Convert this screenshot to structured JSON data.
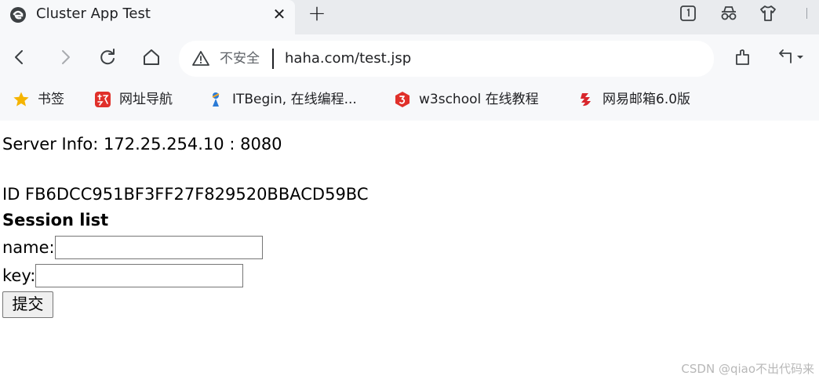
{
  "tab": {
    "title": "Cluster App Test",
    "close_glyph": "✕",
    "new_glyph": "+"
  },
  "toolbar": {
    "security_label": "不安全",
    "url": "haha.com/test.jsp"
  },
  "bookmarks": [
    {
      "label": "书签",
      "icon": "star-icon"
    },
    {
      "label": "网址导航",
      "icon": "red-square-icon"
    },
    {
      "label": "ITBegin, 在线编程...",
      "icon": "itbegin-icon"
    },
    {
      "label": "w3school 在线教程",
      "icon": "w3school-icon"
    },
    {
      "label": "网易邮箱6.0版",
      "icon": "netease-mail-icon"
    }
  ],
  "page": {
    "server_info": "Server Info: 172.25.254.10 : 8080",
    "session_id": "ID FB6DCC951BF3FF27F829520BBACD59BC",
    "session_list_heading": "Session list",
    "name_label": "name:",
    "name_value": "",
    "key_label": "key:",
    "key_value": "",
    "submit_label": "提交"
  },
  "watermark": "CSDN @qiao不出代码来",
  "colors": {
    "accent_red": "#e0302a",
    "star": "#f5b400",
    "text": "#202124"
  }
}
